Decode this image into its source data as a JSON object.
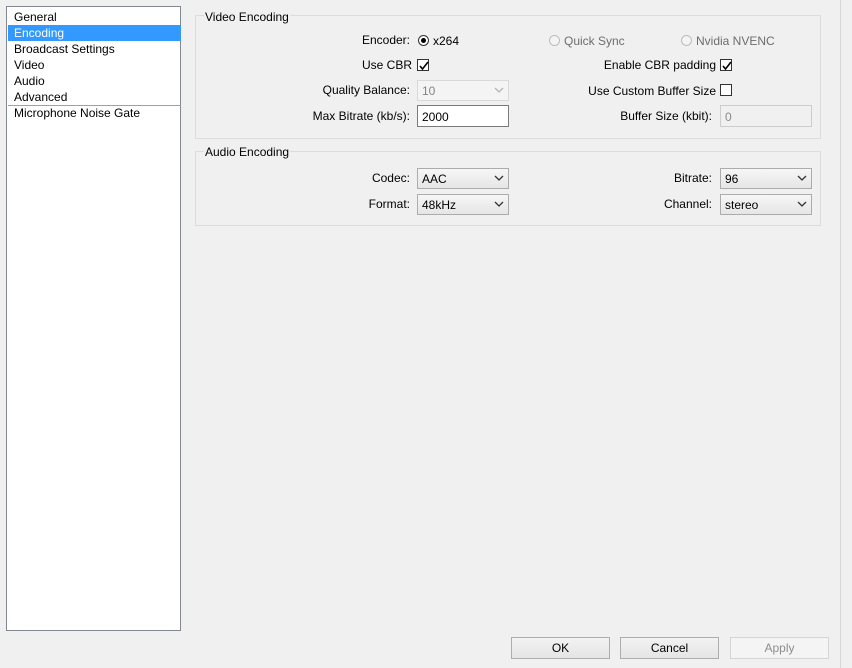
{
  "sidebar": {
    "items": [
      "General",
      "Encoding",
      "Broadcast Settings",
      "Video",
      "Audio",
      "Advanced"
    ],
    "extra_item": "Microphone Noise Gate",
    "selected": "Encoding"
  },
  "video": {
    "title": "Video Encoding",
    "encoder_label": "Encoder:",
    "encoder_options": [
      "x264",
      "Quick Sync",
      "Nvidia NVENC"
    ],
    "use_cbr_label": "Use CBR",
    "use_cbr": true,
    "enable_cbr_padding_label": "Enable CBR padding",
    "enable_cbr_padding": true,
    "quality_balance_label": "Quality Balance:",
    "quality_balance_value": "10",
    "use_custom_buffer_label": "Use Custom Buffer Size",
    "use_custom_buffer": false,
    "max_bitrate_label": "Max Bitrate (kb/s):",
    "max_bitrate_value": "2000",
    "buffer_size_label": "Buffer Size (kbit):",
    "buffer_size_value": "0"
  },
  "audio": {
    "title": "Audio Encoding",
    "codec_label": "Codec:",
    "codec_value": "AAC",
    "bitrate_label": "Bitrate:",
    "bitrate_value": "96",
    "format_label": "Format:",
    "format_value": "48kHz",
    "channel_label": "Channel:",
    "channel_value": "stereo"
  },
  "buttons": {
    "ok": "OK",
    "cancel": "Cancel",
    "apply": "Apply"
  },
  "colors": {
    "selection": "#3399ff"
  }
}
